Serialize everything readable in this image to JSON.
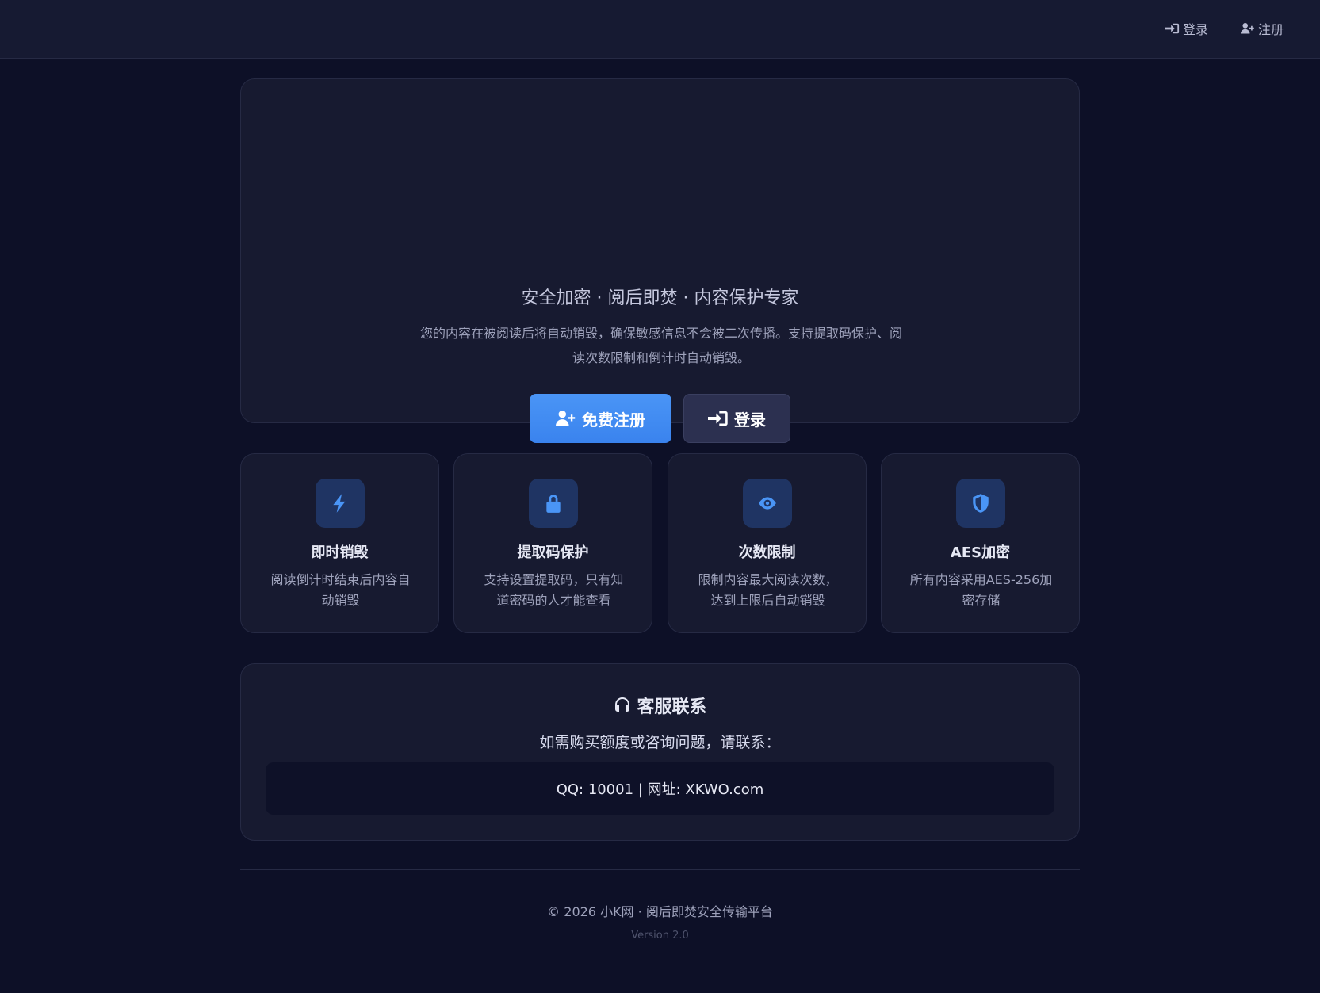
{
  "nav": {
    "login_label": "登录",
    "register_label": "注册"
  },
  "hero": {
    "title": "安全加密 · 阅后即焚 · 内容保护专家",
    "description": "您的内容在被阅读后将自动销毁，确保敏感信息不会被二次传播。支持提取码保护、阅读次数限制和倒计时自动销毁。",
    "register_button": "免费注册",
    "login_button": "登录"
  },
  "features": [
    {
      "icon": "lightning-icon",
      "title": "即时销毁",
      "description": "阅读倒计时结束后内容自动销毁"
    },
    {
      "icon": "lock-icon",
      "title": "提取码保护",
      "description": "支持设置提取码，只有知道密码的人才能查看"
    },
    {
      "icon": "eye-icon",
      "title": "次数限制",
      "description": "限制内容最大阅读次数，达到上限后自动销毁"
    },
    {
      "icon": "shield-icon",
      "title": "AES加密",
      "description": "所有内容采用AES-256加密存储"
    }
  ],
  "support": {
    "title": "客服联系",
    "subtitle": "如需购买额度或咨询问题，请联系：",
    "contact": "QQ: 10001 | 网址: XKWO.com"
  },
  "footer": {
    "copyright": "© 2026 小K网 · 阅后即焚安全传输平台",
    "version": "Version 2.0"
  },
  "colors": {
    "background": "#0d1027",
    "card": "#171a30",
    "accent": "#4a95f6"
  }
}
